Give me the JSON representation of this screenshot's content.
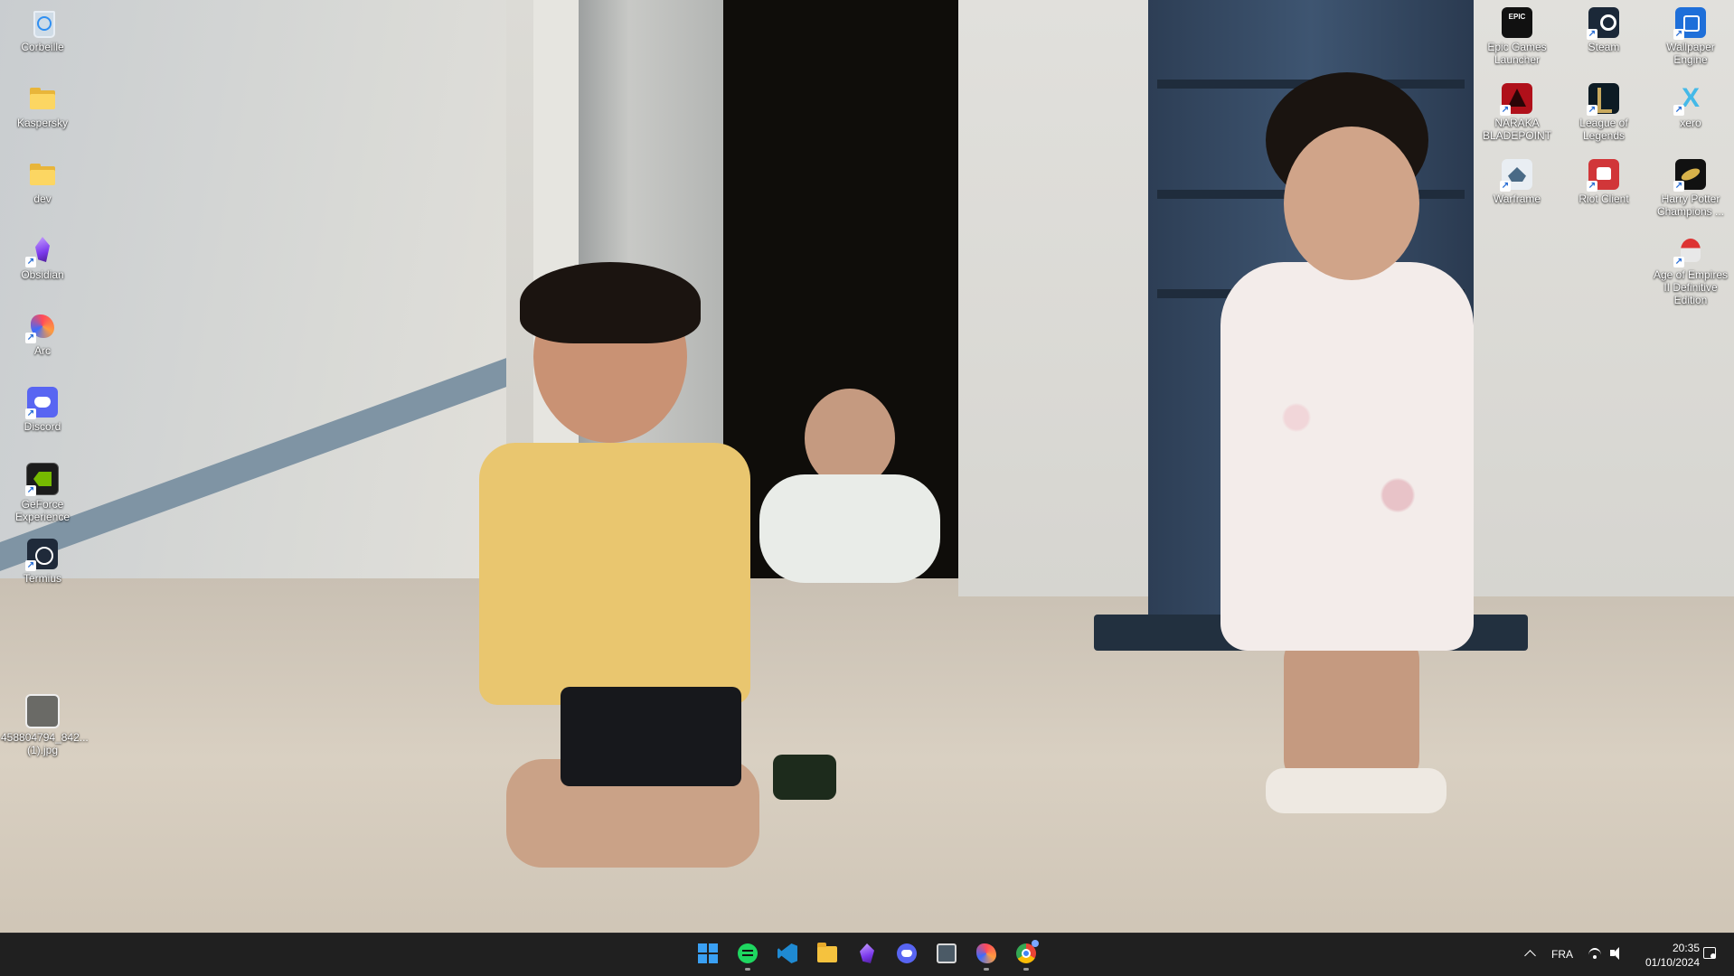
{
  "desktop": {
    "wallpaper": "family photo: three children on a tiled floor",
    "left_icons": [
      {
        "label": "Corbeille",
        "icon": "recycle-bin-icon"
      },
      {
        "label": "Kaspersky",
        "icon": "folder-icon"
      },
      {
        "label": "dev",
        "icon": "folder-icon"
      },
      {
        "label": "Obsidian",
        "icon": "obsidian-icon"
      },
      {
        "label": "Arc",
        "icon": "arc-icon"
      },
      {
        "label": "Discord",
        "icon": "discord-icon"
      },
      {
        "label": "GeForce Experience",
        "icon": "geforce-icon"
      },
      {
        "label": "Termius",
        "icon": "termius-icon"
      },
      {
        "label": "458804794_842... (1).jpg",
        "icon": "image-file-icon"
      }
    ],
    "right_icons": [
      {
        "label": "Epic Games Launcher",
        "icon": "epic-games-icon",
        "logo_text": "EPIC"
      },
      {
        "label": "Steam",
        "icon": "steam-icon"
      },
      {
        "label": "Wallpaper Engine",
        "icon": "wallpaper-engine-icon"
      },
      {
        "label": "NARAKA BLADEPOINT",
        "icon": "naraka-icon"
      },
      {
        "label": "League of Legends",
        "icon": "league-of-legends-icon"
      },
      {
        "label": "xero",
        "icon": "xero-icon"
      },
      {
        "label": "Warframe",
        "icon": "warframe-icon"
      },
      {
        "label": "Riot Client",
        "icon": "riot-client-icon"
      },
      {
        "label": "Harry Potter Champions ...",
        "icon": "harry-potter-icon"
      },
      {
        "label": "Age of Empires II Definitive Edition",
        "icon": "age-of-empires-icon"
      }
    ]
  },
  "taskbar": {
    "apps": [
      {
        "name": "start",
        "icon": "windows-start-icon"
      },
      {
        "name": "spotify",
        "icon": "spotify-icon",
        "running": true
      },
      {
        "name": "vscode",
        "icon": "vscode-icon",
        "running": false
      },
      {
        "name": "file-explorer",
        "icon": "file-explorer-icon",
        "running": false
      },
      {
        "name": "obsidian",
        "icon": "obsidian-icon",
        "running": false
      },
      {
        "name": "discord",
        "icon": "discord-icon",
        "running": false
      },
      {
        "name": "photo-app",
        "icon": "photo-app-icon",
        "running": false
      },
      {
        "name": "arc",
        "icon": "arc-icon",
        "running": true
      },
      {
        "name": "chrome",
        "icon": "chrome-icon",
        "running": true
      }
    ],
    "tray": {
      "language": "FRA",
      "time": "20:35",
      "date": "01/10/2024"
    }
  }
}
